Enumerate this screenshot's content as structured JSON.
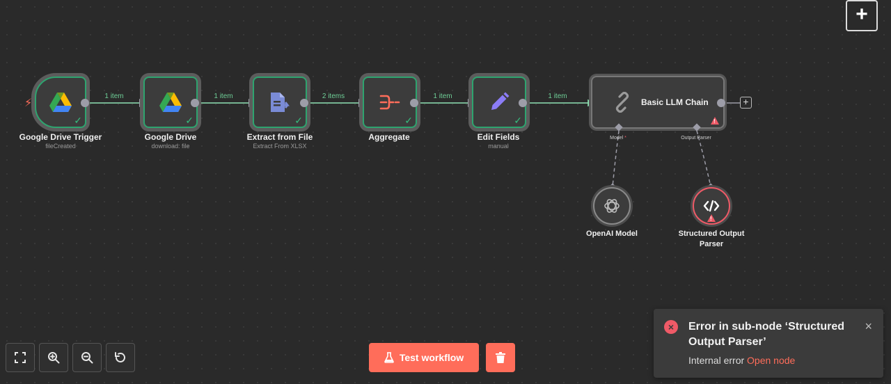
{
  "workflow": {
    "nodes": [
      {
        "id": "gdrive-trigger",
        "label": "Google Drive Trigger",
        "subtitle": "fileCreated",
        "icon": "google-drive-icon"
      },
      {
        "id": "gdrive",
        "label": "Google Drive",
        "subtitle": "download: file",
        "icon": "google-drive-icon"
      },
      {
        "id": "extract",
        "label": "Extract from File",
        "subtitle": "Extract From XLSX",
        "icon": "file-export-icon"
      },
      {
        "id": "aggregate",
        "label": "Aggregate",
        "subtitle": "",
        "icon": "aggregate-icon"
      },
      {
        "id": "edit-fields",
        "label": "Edit Fields",
        "subtitle": "manual",
        "icon": "pencil-icon"
      }
    ],
    "edges": [
      {
        "label": "1 item"
      },
      {
        "label": "1 item"
      },
      {
        "label": "2 items"
      },
      {
        "label": "1 item"
      },
      {
        "label": "1 item"
      }
    ],
    "chain": {
      "label": "Basic LLM Chain",
      "icon": "link-icon",
      "model_label": "Model",
      "model_required": "*",
      "parser_label": "Output Parser"
    },
    "subnodes": [
      {
        "id": "openai",
        "label": "OpenAI Model",
        "icon": "openai-icon"
      },
      {
        "id": "parser",
        "label": "Structured Output Parser",
        "icon": "code-icon"
      }
    ]
  },
  "toolbar": {
    "add_label": "+",
    "test_label": "Test workflow"
  },
  "toast": {
    "title": "Error in sub-node ‘Structured Output Parser’",
    "message": "Internal error",
    "link": "Open node",
    "close": "×"
  },
  "colors": {
    "accent": "#ff6d5a",
    "success": "#2ea46f",
    "error": "#ef5a67",
    "edge": "#6fcf97"
  }
}
